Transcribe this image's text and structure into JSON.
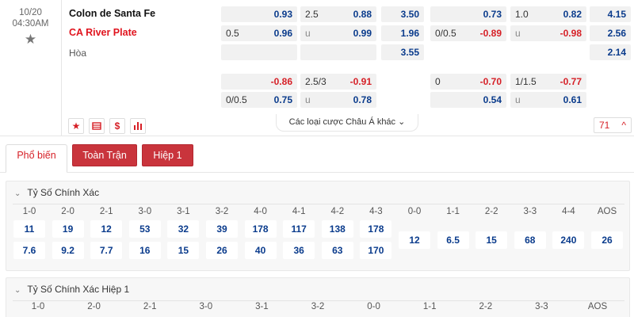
{
  "match": {
    "date": "10/20",
    "time": "04:30AM",
    "home_team": "Colon de Santa Fe",
    "away_team": "CA River Plate",
    "draw_label": "Hòa"
  },
  "odds": {
    "ft_handicap_home": "0.93",
    "ft_handicap_line": "0.5",
    "ft_handicap_away": "0.96",
    "ft_ou_line": "2.5",
    "ft_ou_over": "0.88",
    "ft_ou_under_label": "u",
    "ft_ou_under": "0.99",
    "ft_1x2_home": "3.50",
    "ft_1x2_away": "1.96",
    "ft_1x2_draw": "3.55",
    "ft2_handicap_home": "-0.86",
    "ft2_handicap_line": "0/0.5",
    "ft2_handicap_away": "0.75",
    "ft2_ou_line": "2.5/3",
    "ft2_ou_over": "-0.91",
    "ft2_ou_under_label": "u",
    "ft2_ou_under": "0.78",
    "h1_handicap_home": "0.73",
    "h1_handicap_line": "0/0.5",
    "h1_handicap_away": "-0.89",
    "h1_ou_line": "1.0",
    "h1_ou_over": "0.82",
    "h1_ou_under_label": "u",
    "h1_ou_under": "-0.98",
    "h1_1x2_home": "4.15",
    "h1_1x2_away": "2.56",
    "h1_1x2_draw": "2.14",
    "h12_handicap_line_top": "0",
    "h12_handicap_home": "-0.70",
    "h12_handicap_away": "0.54",
    "h12_ou_line": "1/1.5",
    "h12_ou_over": "-0.77",
    "h12_ou_under_label": "u",
    "h12_ou_under": "0.61"
  },
  "actions": {
    "more_bets": "Các loại cược Châu Á khác",
    "count": "71",
    "dollar": "$"
  },
  "tabs": {
    "popular": "Phổ biến",
    "full_match": "Toàn Trận",
    "half1": "Hiệp 1"
  },
  "correct_score": {
    "title": "Tỷ Số Chính Xác",
    "headers": [
      "1-0",
      "2-0",
      "2-1",
      "3-0",
      "3-1",
      "3-2",
      "4-0",
      "4-1",
      "4-2",
      "4-3",
      "0-0",
      "1-1",
      "2-2",
      "3-3",
      "4-4",
      "AOS"
    ],
    "home": [
      "11",
      "19",
      "12",
      "53",
      "32",
      "39",
      "178",
      "117",
      "138",
      "178"
    ],
    "away": [
      "7.6",
      "9.2",
      "7.7",
      "16",
      "15",
      "26",
      "40",
      "36",
      "63",
      "170"
    ],
    "draw": [
      "12",
      "6.5",
      "15",
      "68",
      "240",
      "26"
    ]
  },
  "correct_score_h1": {
    "title": "Tỷ Số Chính Xác Hiệp 1",
    "headers": [
      "1-0",
      "2-0",
      "2-1",
      "3-0",
      "3-1",
      "3-2",
      "0-0",
      "1-1",
      "2-2",
      "3-3",
      "AOS"
    ]
  },
  "colors": {
    "accent_red": "#c9343c",
    "odds_blue": "#0a3b8c",
    "negative_red": "#d61f26"
  }
}
